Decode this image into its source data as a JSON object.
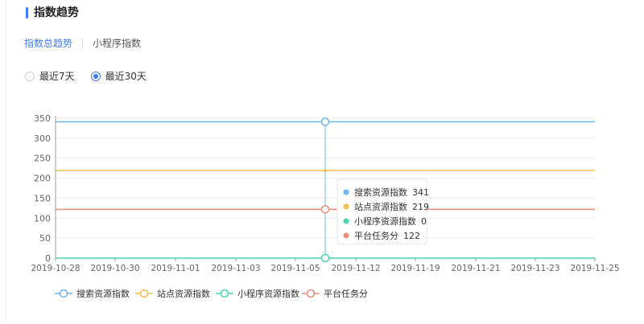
{
  "header": {
    "title": "指数趋势"
  },
  "tabs": [
    {
      "label": "指数总趋势",
      "active": true
    },
    {
      "label": "小程序指数",
      "active": false
    }
  ],
  "range": {
    "options": [
      {
        "label": "最近7天",
        "checked": false
      },
      {
        "label": "最近30天",
        "checked": true
      }
    ]
  },
  "chart_data": {
    "type": "line",
    "ylim": [
      0,
      350
    ],
    "y_ticks": [
      "0",
      "50",
      "100",
      "150",
      "200",
      "250",
      "300",
      "350"
    ],
    "x_tick_labels": [
      "2019-10-28",
      "2019-10-30",
      "2019-11-01",
      "2019-11-03",
      "2019-11-05",
      "2019-11-12",
      "2019-11-19",
      "2019-11-21",
      "2019-11-23",
      "2019-11-25"
    ],
    "grid": true,
    "legend_position": "bottom-left",
    "series": [
      {
        "name": "搜索资源指数",
        "color": "#6cb5f2",
        "value": 341
      },
      {
        "name": "站点资源指数",
        "color": "#f2bd4a",
        "value": 219
      },
      {
        "name": "小程序资源指数",
        "color": "#48d3ae",
        "value": 0
      },
      {
        "name": "平台任务分",
        "color": "#f08a73",
        "value": 122
      }
    ],
    "tooltip": {
      "items": [
        {
          "name": "搜索资源指数",
          "value": "341"
        },
        {
          "name": "站点资源指数",
          "value": "219"
        },
        {
          "name": "小程序资源指数",
          "value": "0"
        },
        {
          "name": "平台任务分",
          "value": "122"
        }
      ]
    }
  }
}
